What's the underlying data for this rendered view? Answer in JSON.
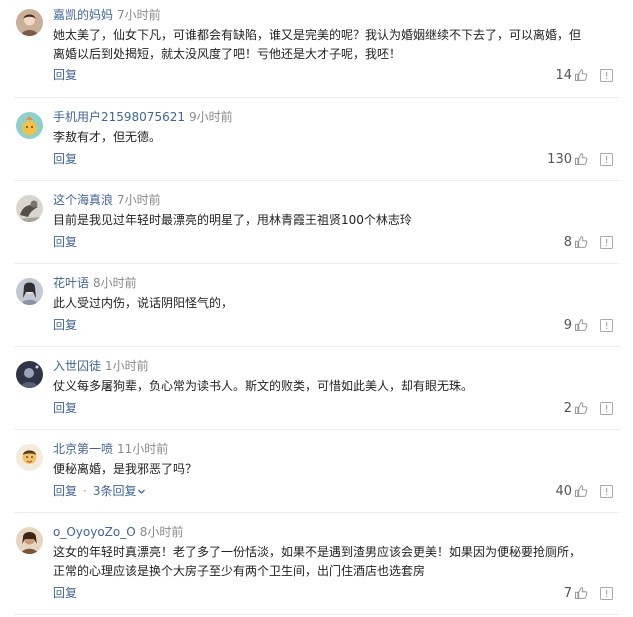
{
  "comments": [
    {
      "username": "嘉凯的妈妈",
      "time": "7小时前",
      "lines": [
        "她太美了，仙女下凡，可谁都会有缺陷，谁又是完美的呢？我认为婚姻继续不下去了，可以离婚，但",
        "离婚以后到处揭短，就太没风度了吧！亏他还是大才子呢，我呸！"
      ],
      "reply_label": "回复",
      "likes": "14",
      "avatar_color": "#b89a86"
    },
    {
      "username": "手机用户21598075621",
      "time": "9小时前",
      "lines": [
        "李敖有才，但无德。"
      ],
      "reply_label": "回复",
      "likes": "130",
      "avatar_color": "#86c6c4"
    },
    {
      "username": "这个海真浪",
      "time": "7小时前",
      "lines": [
        "目前是我见过年轻时最漂亮的明星了，甩林青霞王祖贤100个林志玲"
      ],
      "reply_label": "回复",
      "likes": "8",
      "avatar_color": "#6f6a63"
    },
    {
      "username": "花叶语",
      "time": "8小时前",
      "lines": [
        "此人受过内伤，说话阴阳怪气的，"
      ],
      "reply_label": "回复",
      "likes": "9",
      "avatar_color": "#b8bcc6"
    },
    {
      "username": "入世囚徒",
      "time": "1小时前",
      "lines": [
        "仗义每多屠狗辈，负心常为读书人。斯文的败类，可惜如此美人，却有眼无珠。"
      ],
      "reply_label": "回复",
      "likes": "2",
      "avatar_color": "#3a3f52"
    },
    {
      "username": "北京第一喷",
      "time": "11小时前",
      "lines": [
        "便秘离婚，是我邪恶了吗？"
      ],
      "reply_label": "回复",
      "replies_label": "3条回复",
      "likes": "40",
      "avatar_color": "#e9c07a"
    },
    {
      "username": "o_OyoyoZo_O",
      "time": "8小时前",
      "lines": [
        "这女的年轻时真漂亮！老了多了一份恬淡，如果不是遇到渣男应该会更美！如果因为便秘要抢厕所，",
        "正常的心理应该是换个大房子至少有两个卫生间，出门住酒店也选套房"
      ],
      "reply_label": "回复",
      "likes": "7",
      "avatar_color": "#8b6a4a"
    }
  ],
  "icons": {
    "like": "thumbs-up-icon",
    "report": "report-flag-icon",
    "expand": "chevron-down-icon"
  },
  "colors": {
    "link": "#406599",
    "meta": "#8a8a8a",
    "text": "#222222",
    "divider": "#ececec"
  }
}
